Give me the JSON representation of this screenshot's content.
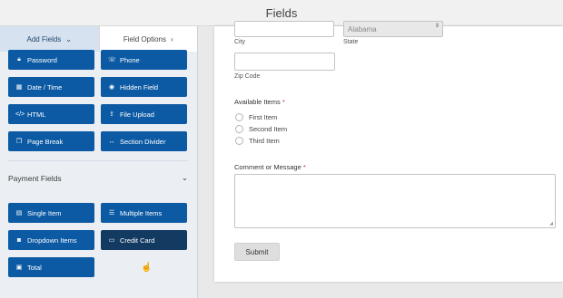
{
  "window": {
    "title": "Fields"
  },
  "left_panel": {
    "tabs": {
      "add_fields": "Add Fields",
      "add_fields_icon": "chevron-down-icon",
      "field_options": "Field Options",
      "field_options_icon": "chevron-right-icon"
    },
    "fancy_fields": [
      {
        "label": "Password",
        "icon": "lock-icon"
      },
      {
        "label": "Phone",
        "icon": "phone-icon"
      },
      {
        "label": "Date / Time",
        "icon": "calendar-icon"
      },
      {
        "label": "Hidden Field",
        "icon": "eye-slash-icon"
      },
      {
        "label": "HTML",
        "icon": "code-icon"
      },
      {
        "label": "File Upload",
        "icon": "upload-icon"
      },
      {
        "label": "Page Break",
        "icon": "copy-icon"
      },
      {
        "label": "Section Divider",
        "icon": "divider-icon"
      }
    ],
    "payment_section": {
      "title": "Payment Fields",
      "icon": "chevron-down-icon"
    },
    "payment_fields": [
      {
        "label": "Single Item",
        "icon": "file-icon"
      },
      {
        "label": "Multiple Items",
        "icon": "list-icon"
      },
      {
        "label": "Dropdown Items",
        "icon": "dropdown-icon"
      },
      {
        "label": "Credit Card",
        "icon": "credit-card-icon"
      },
      {
        "label": "Total",
        "icon": "money-icon"
      }
    ]
  },
  "form_preview": {
    "address": {
      "city_label": "City",
      "state_label": "State",
      "state_value": "Alabama",
      "zip_label": "Zip Code"
    },
    "available_items": {
      "label": "Available Items",
      "required_mark": "*",
      "options": [
        "First Item",
        "Second Item",
        "Third Item"
      ]
    },
    "comment": {
      "label": "Comment or Message",
      "required_mark": "*"
    },
    "submit_label": "Submit"
  },
  "colors": {
    "button_blue": "#0c5aa4",
    "button_active": "#133b62",
    "panel_bg": "#ebeff4"
  }
}
